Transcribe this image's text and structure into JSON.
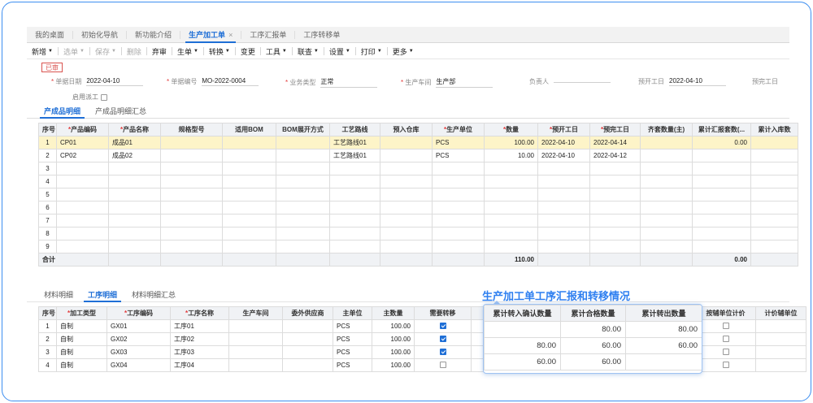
{
  "tabs": [
    {
      "label": "我的桌面",
      "active": false
    },
    {
      "label": "初始化导航",
      "active": false
    },
    {
      "label": "新功能介绍",
      "active": false
    },
    {
      "label": "生产加工单",
      "active": true
    },
    {
      "label": "工序汇报单",
      "active": false
    },
    {
      "label": "工序转移单",
      "active": false
    }
  ],
  "tab_close_glyph": "×",
  "toolbar": {
    "new": "新增",
    "select_doc": "选单",
    "save": "保存",
    "delete": "删除",
    "abandon": "弃审",
    "produce": "生单",
    "convert": "转换",
    "change": "变更",
    "tools": "工具",
    "query": "联查",
    "settings": "设置",
    "print": "打印",
    "more": "更多"
  },
  "status_stamp": "已审",
  "form": {
    "doc_date_label": "单据日期",
    "doc_date": "2022-04-10",
    "doc_no_label": "单据编号",
    "doc_no": "MO-2022-0004",
    "biz_type_label": "业务类型",
    "biz_type": "正常",
    "workshop_label": "生产车间",
    "workshop": "生产部",
    "owner_label": "负责人",
    "owner": "",
    "plan_start_label": "预开工日",
    "plan_start": "2022-04-10",
    "plan_end_label": "预完工日",
    "plan_end": "",
    "dispatch_label": "启用派工"
  },
  "upper_subtabs": {
    "detail": "产成品明细",
    "summary": "产成品明细汇总"
  },
  "product_table": {
    "headers": {
      "seq": "序号",
      "code": "产品编码",
      "name": "产品名称",
      "spec": "规格型号",
      "bom": "适用BOM",
      "bom_mode": "BOM展开方式",
      "route": "工艺路线",
      "warehouse": "预入仓库",
      "unit": "生产单位",
      "qty": "数量",
      "start": "预开工日",
      "end": "预完工日",
      "kit_qty": "齐套数量(主)",
      "reported": "累计汇报套数(...",
      "stocked": "累计入库数"
    },
    "rows": [
      {
        "seq": "1",
        "code": "CP01",
        "name": "成品01",
        "route": "工艺路线01",
        "unit": "PCS",
        "qty": "100.00",
        "start": "2022-04-10",
        "end": "2022-04-14",
        "reported": "0.00"
      },
      {
        "seq": "2",
        "code": "CP02",
        "name": "成品02",
        "route": "工艺路线01",
        "unit": "PCS",
        "qty": "10.00",
        "start": "2022-04-10",
        "end": "2022-04-12",
        "reported": ""
      },
      {
        "seq": "3"
      },
      {
        "seq": "4"
      },
      {
        "seq": "5"
      },
      {
        "seq": "6"
      },
      {
        "seq": "7"
      },
      {
        "seq": "8"
      },
      {
        "seq": "9"
      }
    ],
    "total_label": "合计",
    "total_qty": "110.00",
    "total_reported": "0.00"
  },
  "lower_subtabs": {
    "material": "材料明细",
    "process": "工序明细",
    "material_summary": "材料明细汇总"
  },
  "process_table": {
    "headers": {
      "seq": "序号",
      "type": "加工类型",
      "code": "工序编码",
      "name": "工序名称",
      "workshop": "生产车间",
      "supplier": "委外供应商",
      "unit": "主单位",
      "qty": "主数量",
      "need_transfer": "需要转移",
      "aux_price": "按辅单位计价",
      "aux_unit": "计价辅单位"
    },
    "rows": [
      {
        "seq": "1",
        "type": "自制",
        "code": "GX01",
        "name": "工序01",
        "unit": "PCS",
        "qty": "100.00",
        "need_transfer": true
      },
      {
        "seq": "2",
        "type": "自制",
        "code": "GX02",
        "name": "工序02",
        "unit": "PCS",
        "qty": "100.00",
        "need_transfer": true
      },
      {
        "seq": "3",
        "type": "自制",
        "code": "GX03",
        "name": "工序03",
        "unit": "PCS",
        "qty": "100.00",
        "need_transfer": true
      },
      {
        "seq": "4",
        "type": "自制",
        "code": "GX04",
        "name": "工序04",
        "unit": "PCS",
        "qty": "100.00",
        "need_transfer": false
      }
    ]
  },
  "callout": {
    "title": "生产加工单工序汇报和转移情况",
    "headers": {
      "in_confirmed": "累计转入确认数量",
      "passed": "累计合格数量",
      "out_qty": "累计转出数量"
    },
    "rows": [
      {
        "in_confirmed": "",
        "passed": "80.00",
        "out_qty": "80.00"
      },
      {
        "in_confirmed": "80.00",
        "passed": "60.00",
        "out_qty": "60.00"
      },
      {
        "in_confirmed": "60.00",
        "passed": "60.00",
        "out_qty": ""
      }
    ]
  },
  "colors": {
    "accent": "#1f6fd6",
    "frame": "#3d8ef0",
    "selected_row": "#fdf4c8",
    "required": "#e23b3b",
    "stamp": "#d9534f"
  }
}
